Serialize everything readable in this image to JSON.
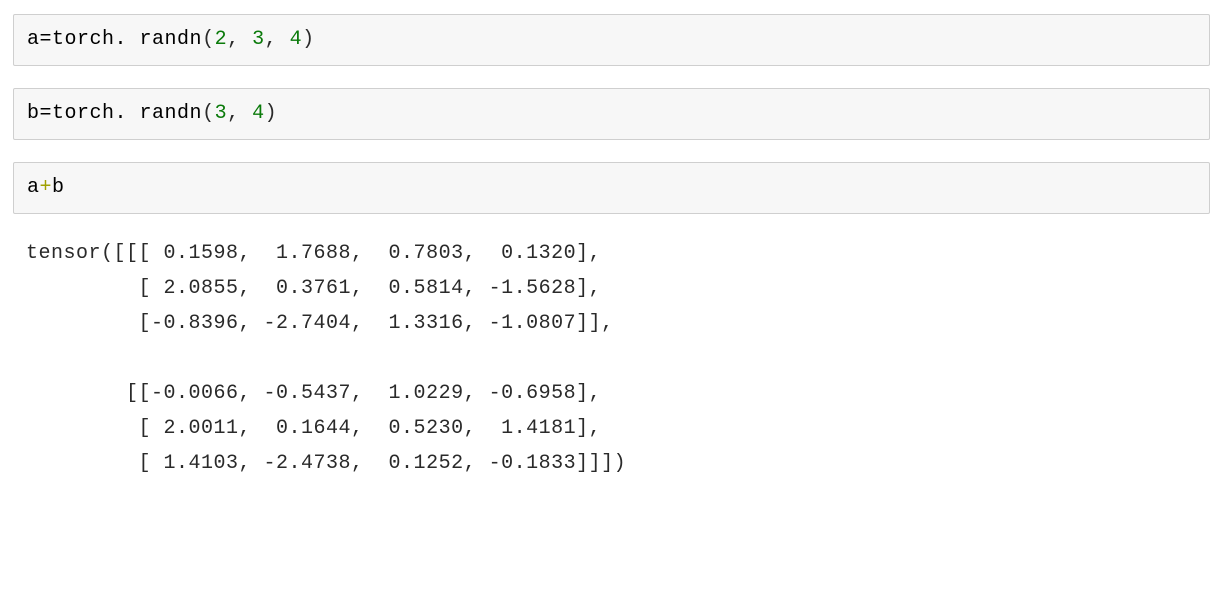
{
  "cell1": {
    "var": "a",
    "eq": "=",
    "fn": "torch. randn",
    "open": "(",
    "a1": "2",
    "c1": ", ",
    "a2": "3",
    "c2": ", ",
    "a3": "4",
    "close": ")"
  },
  "cell2": {
    "var": "b",
    "eq": "=",
    "fn": "torch. randn",
    "open": "(",
    "a1": "3",
    "c1": ", ",
    "a2": "4",
    "close": ")"
  },
  "cell3": {
    "var1": "a",
    "op": "+",
    "var2": "b"
  },
  "output": "tensor([[[ 0.1598,  1.7688,  0.7803,  0.1320],\n         [ 2.0855,  0.3761,  0.5814, -1.5628],\n         [-0.8396, -2.7404,  1.3316, -1.0807]],\n\n        [[-0.0066, -0.5437,  1.0229, -0.6958],\n         [ 2.0011,  0.1644,  0.5230,  1.4181],\n         [ 1.4103, -2.4738,  0.1252, -0.1833]]])"
}
